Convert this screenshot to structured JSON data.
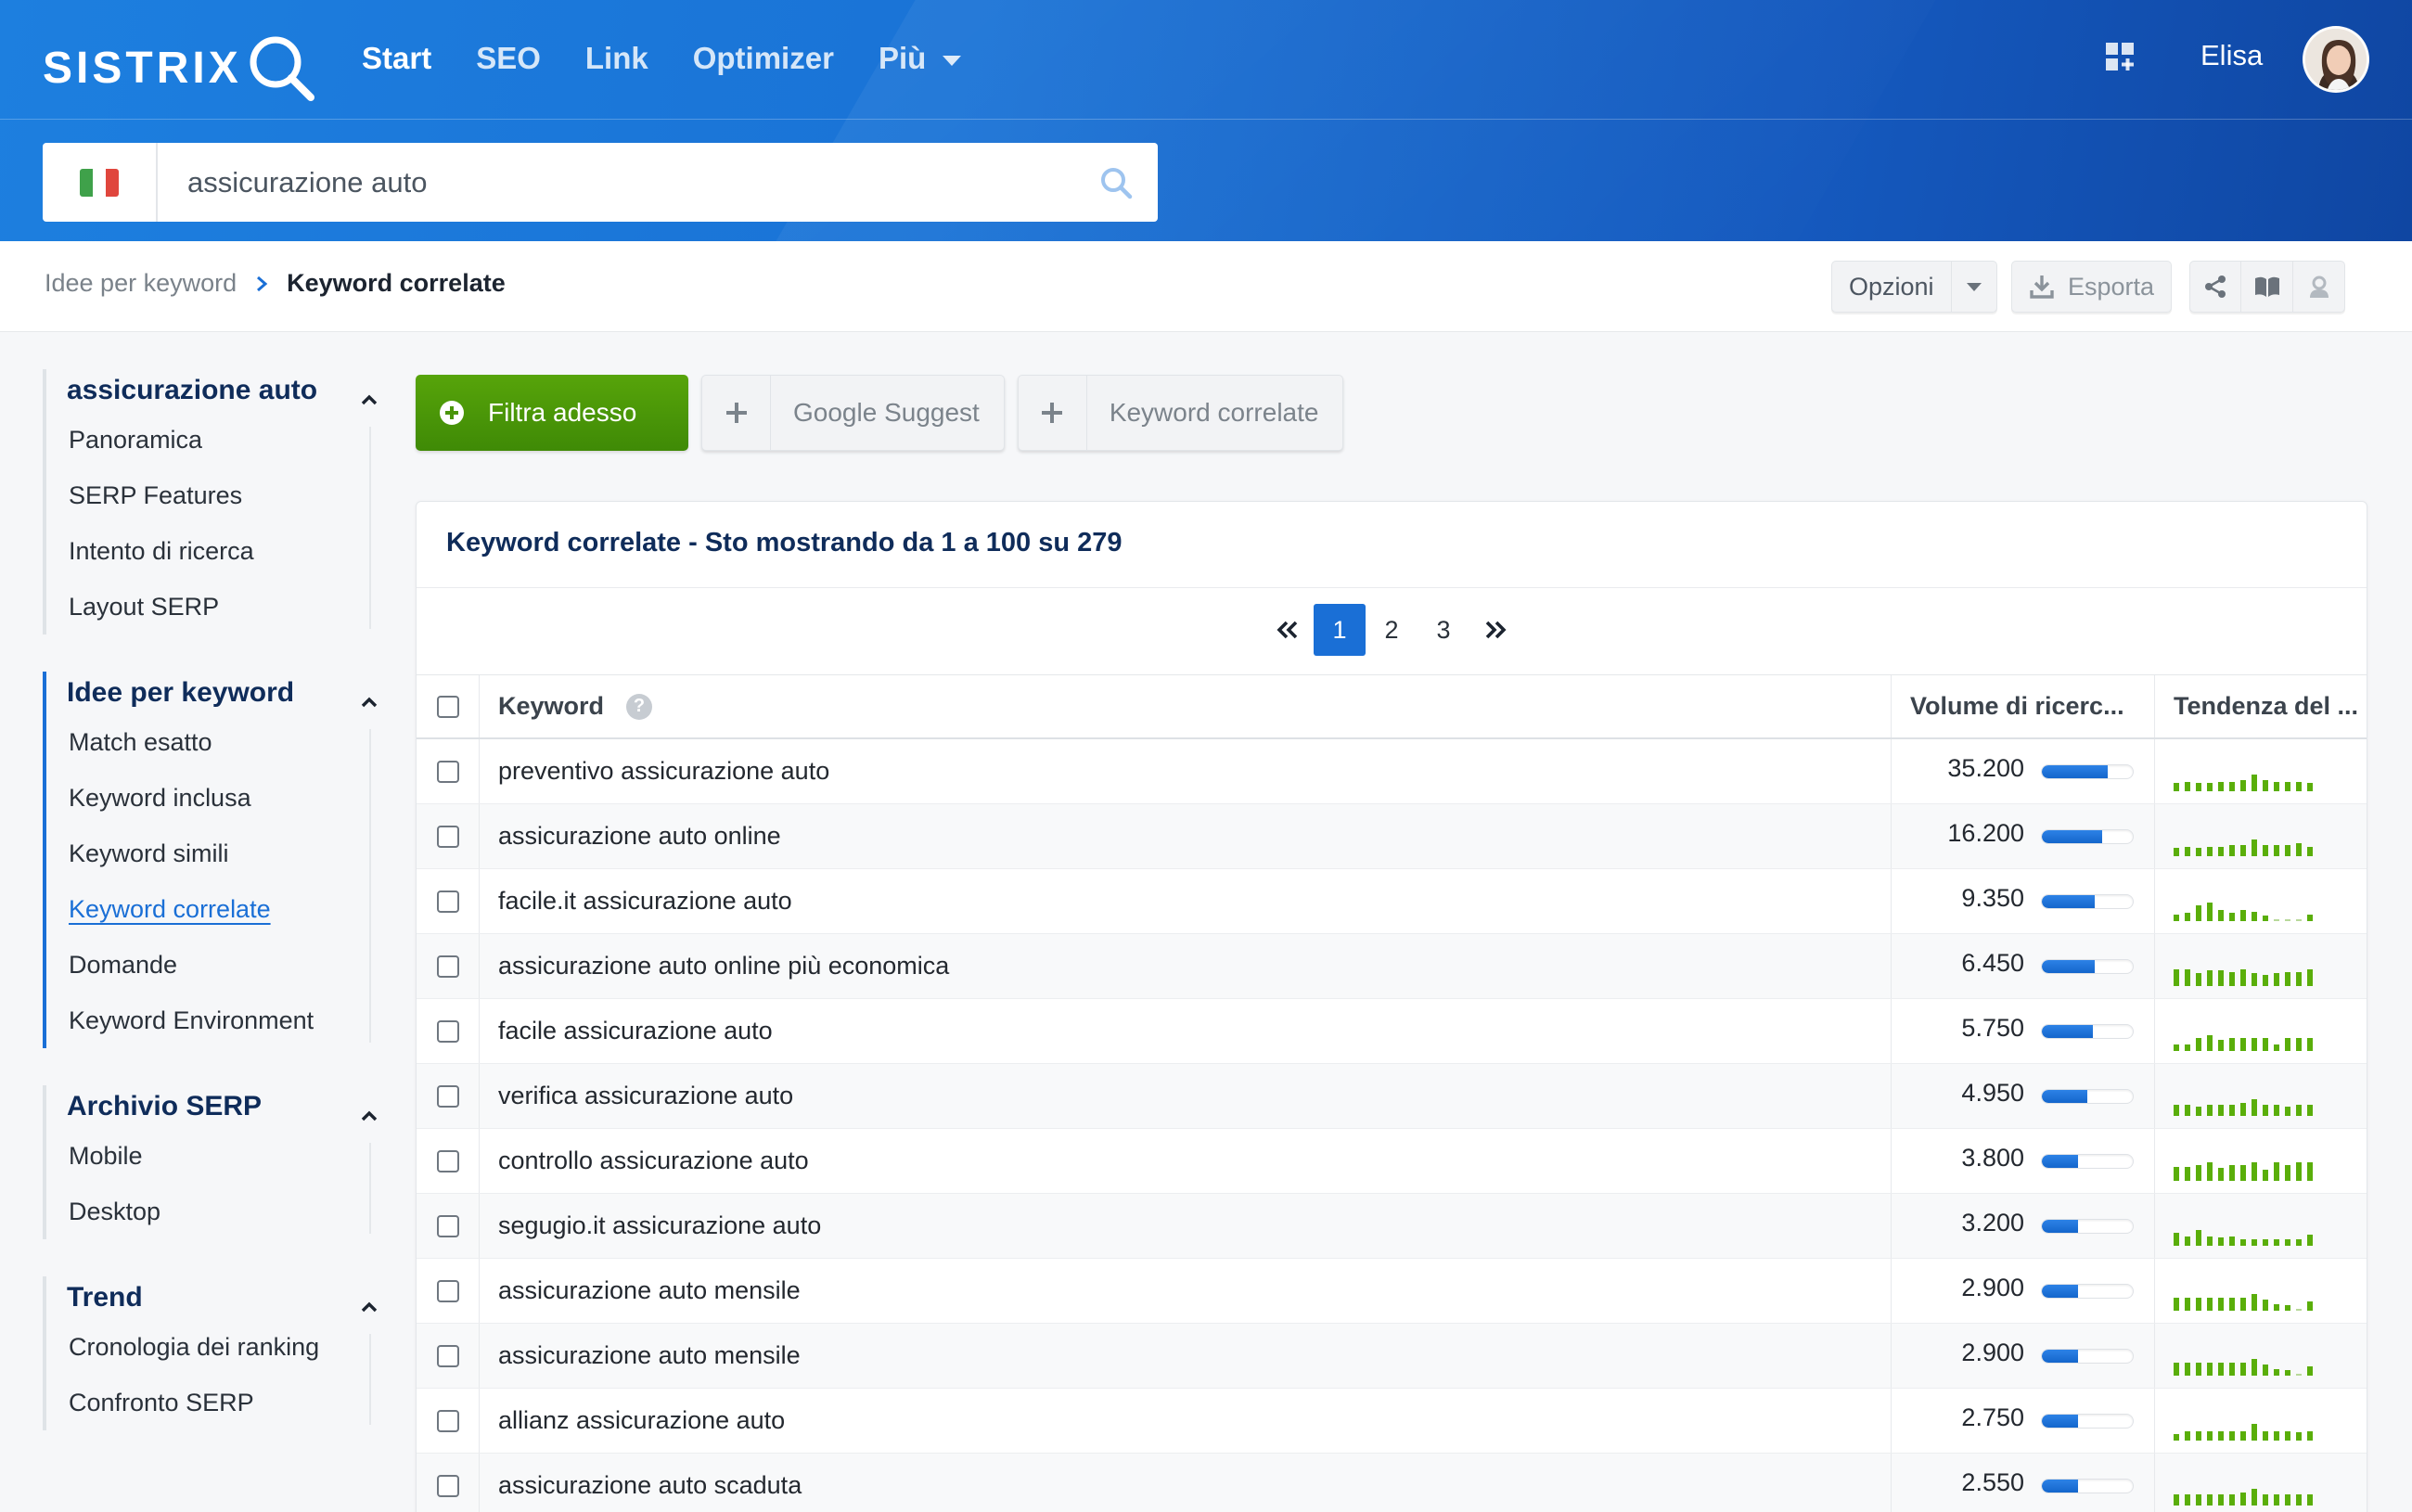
{
  "header": {
    "logo": "SISTRIX",
    "nav": [
      {
        "label": "Start",
        "active": true
      },
      {
        "label": "SEO",
        "active": false
      },
      {
        "label": "Link",
        "active": false
      },
      {
        "label": "Optimizer",
        "active": false
      },
      {
        "label": "Più",
        "active": false,
        "dropdown": true
      }
    ],
    "user_name": "Elisa",
    "search": {
      "value": "assicurazione auto",
      "country": "Italy"
    }
  },
  "breadcrumb": {
    "parent": "Idee per keyword",
    "current": "Keyword correlate"
  },
  "toolbar": {
    "options_label": "Opzioni",
    "export_label": "Esporta"
  },
  "sidebar": {
    "groups": [
      {
        "title": "assicurazione auto",
        "items": [
          "Panoramica",
          "SERP Features",
          "Intento di ricerca",
          "Layout SERP"
        ]
      },
      {
        "title": "Idee per keyword",
        "current": true,
        "items": [
          "Match esatto",
          "Keyword inclusa",
          "Keyword simili",
          "Keyword correlate",
          "Domande",
          "Keyword Environment"
        ],
        "active_item": "Keyword correlate"
      },
      {
        "title": "Archivio SERP",
        "items": [
          "Mobile",
          "Desktop"
        ]
      },
      {
        "title": "Trend",
        "items": [
          "Cronologia dei ranking",
          "Confronto SERP"
        ]
      }
    ]
  },
  "filters": {
    "primary": "Filtra adesso",
    "chips": [
      "Google Suggest",
      "Keyword correlate"
    ]
  },
  "panel": {
    "title": "Keyword correlate - Sto mostrando da 1 a 100 su 279",
    "pagination": {
      "current": "1",
      "pages": [
        "1",
        "2",
        "3"
      ]
    },
    "columns": {
      "keyword": "Keyword",
      "volume": "Volume di ricerc...",
      "trend": "Tendenza del ..."
    },
    "rows": [
      {
        "keyword": "preventivo assicurazione auto",
        "volume": "35.200",
        "fill": 0.72,
        "trend": [
          3,
          4,
          3,
          3,
          4,
          4,
          5,
          9,
          5,
          4,
          4,
          4,
          3
        ]
      },
      {
        "keyword": "assicurazione auto online",
        "volume": "16.200",
        "fill": 0.66,
        "trend": [
          3,
          4,
          3,
          4,
          4,
          5,
          5,
          9,
          5,
          5,
          5,
          6,
          4
        ]
      },
      {
        "keyword": "facile.it assicurazione auto",
        "volume": "9.350",
        "fill": 0.58,
        "trend": [
          2,
          3,
          8,
          10,
          5,
          3,
          5,
          4,
          1,
          0,
          0,
          0,
          2
        ]
      },
      {
        "keyword": "assicurazione auto online più economica",
        "volume": "6.450",
        "fill": 0.58,
        "trend": [
          9,
          9,
          6,
          8,
          8,
          7,
          9,
          6,
          5,
          6,
          7,
          7,
          9
        ]
      },
      {
        "keyword": "facile assicurazione auto",
        "volume": "5.750",
        "fill": 0.56,
        "trend": [
          2,
          2,
          6,
          8,
          5,
          6,
          6,
          6,
          6,
          2,
          6,
          6,
          6
        ]
      },
      {
        "keyword": "verifica assicurazione auto",
        "volume": "4.950",
        "fill": 0.5,
        "trend": [
          5,
          5,
          4,
          5,
          5,
          5,
          6,
          9,
          5,
          5,
          4,
          5,
          5
        ]
      },
      {
        "keyword": "controllo assicurazione auto",
        "volume": "3.800",
        "fill": 0.4,
        "trend": [
          7,
          7,
          8,
          10,
          6,
          8,
          8,
          10,
          5,
          10,
          8,
          10,
          10
        ]
      },
      {
        "keyword": "segugio.it assicurazione auto",
        "volume": "3.200",
        "fill": 0.4,
        "trend": [
          6,
          4,
          8,
          4,
          3,
          4,
          2,
          2,
          2,
          2,
          2,
          2,
          5
        ]
      },
      {
        "keyword": "assicurazione auto mensile",
        "volume": "2.900",
        "fill": 0.4,
        "trend": [
          6,
          6,
          6,
          6,
          6,
          6,
          6,
          9,
          5,
          2,
          1,
          0,
          4
        ]
      },
      {
        "keyword": "assicurazione auto mensile",
        "volume": "2.900",
        "fill": 0.4,
        "trend": [
          6,
          6,
          6,
          6,
          6,
          6,
          6,
          9,
          5,
          2,
          1,
          0,
          4
        ]
      },
      {
        "keyword": "allianz assicurazione auto",
        "volume": "2.750",
        "fill": 0.4,
        "trend": [
          2,
          4,
          4,
          4,
          4,
          4,
          4,
          9,
          4,
          4,
          4,
          3,
          4
        ]
      },
      {
        "keyword": "assicurazione auto scaduta",
        "volume": "2.550",
        "fill": 0.4,
        "trend": [
          5,
          5,
          5,
          5,
          5,
          5,
          6,
          9,
          5,
          5,
          5,
          5,
          5
        ]
      }
    ]
  },
  "colors": {
    "accent": "#1a6fd6",
    "brand_header": "#1a6ad2",
    "green": "#4e9a08",
    "trend_green": "#5aae0a"
  }
}
